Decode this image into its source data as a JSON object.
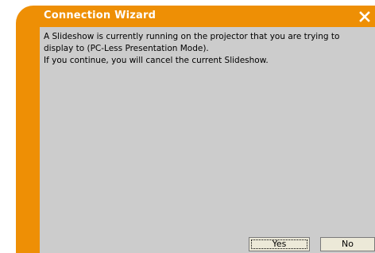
{
  "window": {
    "title": "Connection Wizard",
    "close_icon": "close-x-icon",
    "accent_color": "#ee8f05",
    "content_bg": "#cccccc"
  },
  "message": {
    "line1": "A Slideshow is currently running on the projector that you are trying to display to (PC-Less Presentation Mode).",
    "line2": "If you continue, you will cancel the current Slideshow."
  },
  "buttons": {
    "yes_label": "Yes",
    "no_label": "No"
  }
}
